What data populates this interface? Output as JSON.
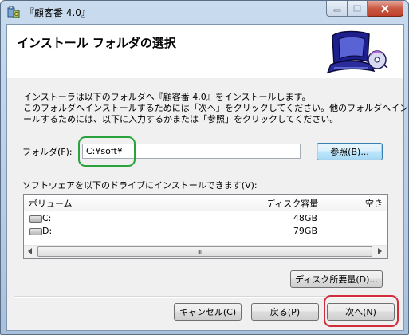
{
  "window": {
    "title": "『顧客番 4.0』",
    "icon": "installer-icon",
    "caption_buttons": [
      "minimize-icon",
      "maximize-icon",
      "close-icon"
    ]
  },
  "banner": {
    "title": "インストール フォルダの選択",
    "graphic": "computer-cd-icon"
  },
  "intro": {
    "line1": "インストーラは以下のフォルダへ『顧客番 4.0』をインストールします。",
    "line2": "このフォルダへインストールするためには「次へ」をクリックしてください。他のフォルダへインスト",
    "line3": "ールするためには、以下に入力するかまたは「参照」をクリックしてください。"
  },
  "folder": {
    "label": "フォルダ(F):",
    "value": "C:¥soft¥",
    "browse_label": "参照(B)..."
  },
  "drives": {
    "caption": "ソフトウェアを以下のドライブにインストールできます(V):",
    "columns": {
      "volume": "ボリューム",
      "capacity": "ディスク容量",
      "free": "空き"
    },
    "rows": [
      {
        "name": "C:",
        "capacity": "48GB"
      },
      {
        "name": "D:",
        "capacity": "79GB"
      }
    ],
    "scroll_grip": "III",
    "disk_cost_label": "ディスク所要量(D)..."
  },
  "footer": {
    "cancel_label": "キャンセル(C)",
    "back_label": "戻る(P)",
    "next_label": "次へ(N)"
  },
  "annotation_colors": {
    "folder_highlight": "#2aa33c",
    "next_highlight": "#d12d3a"
  }
}
